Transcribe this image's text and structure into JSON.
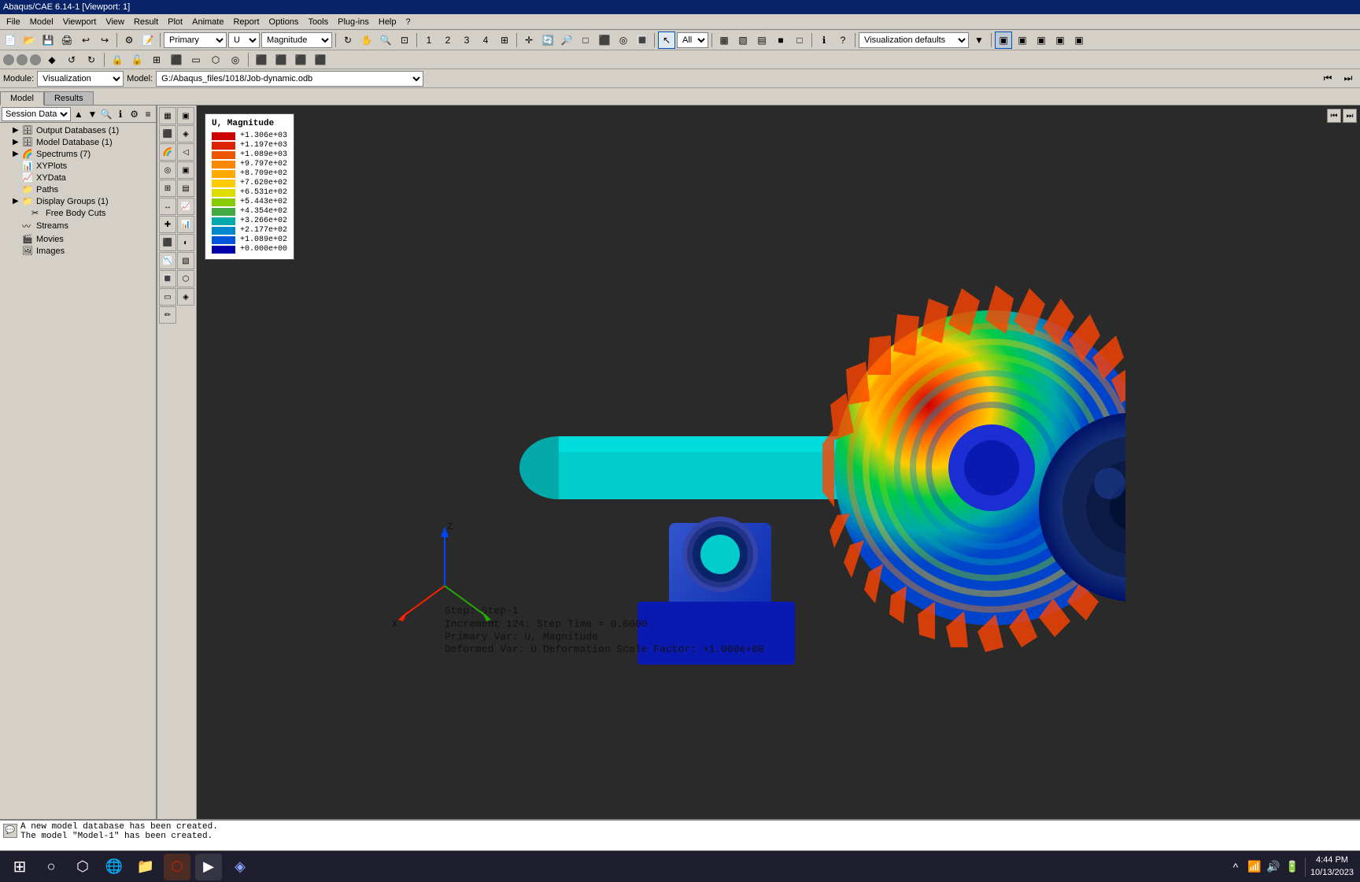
{
  "titlebar": {
    "text": "Abaqus/CAE 6.14-1 [Viewport: 1]"
  },
  "menubar": {
    "items": [
      "File",
      "Model",
      "Viewport",
      "View",
      "Result",
      "Plot",
      "Animate",
      "Report",
      "Options",
      "Tools",
      "Plug-ins",
      "Help",
      "?"
    ]
  },
  "toolbar1": {
    "module_label": "Module:",
    "module_value": "Visualization",
    "model_label": "Model:",
    "model_value": "G:/Abaqus_files/1018/Job-dynamic.odb",
    "primary_value": "Primary",
    "deform_value": "U",
    "contour_value": "Magnitude"
  },
  "tabs": {
    "model": "Model",
    "results": "Results"
  },
  "session": {
    "label": "Session Data",
    "dropdown_value": "Session Data"
  },
  "tree": {
    "items": [
      {
        "id": "output-db",
        "label": "Output Databases (1)",
        "indent": 1,
        "icon": "📁",
        "expand": "▶"
      },
      {
        "id": "model-db",
        "label": "Model Database (1)",
        "indent": 1,
        "icon": "📁",
        "expand": "▶"
      },
      {
        "id": "spectrums",
        "label": "Spectrums (7)",
        "indent": 1,
        "icon": "📁",
        "expand": "▶"
      },
      {
        "id": "xyplots",
        "label": "XYPlots",
        "indent": 1,
        "icon": "📊",
        "expand": " "
      },
      {
        "id": "xydata",
        "label": "XYData",
        "indent": 1,
        "icon": "📈",
        "expand": " "
      },
      {
        "id": "paths",
        "label": "Paths",
        "indent": 1,
        "icon": "📁",
        "expand": " "
      },
      {
        "id": "display-groups",
        "label": "Display Groups (1)",
        "indent": 1,
        "icon": "📁",
        "expand": "▶"
      },
      {
        "id": "free-body",
        "label": "Free Body Cuts",
        "indent": 2,
        "icon": "✂",
        "expand": " "
      },
      {
        "id": "streams",
        "label": "Streams",
        "indent": 1,
        "icon": "〰",
        "expand": " "
      },
      {
        "id": "movies",
        "label": "Movies",
        "indent": 1,
        "icon": "🎬",
        "expand": " "
      },
      {
        "id": "images",
        "label": "Images",
        "indent": 1,
        "icon": "🖼",
        "expand": " "
      }
    ]
  },
  "legend": {
    "title": "U, Magnitude",
    "entries": [
      {
        "color": "#cc0000",
        "value": "+1.306e+03"
      },
      {
        "color": "#dd2200",
        "value": "+1.197e+03"
      },
      {
        "color": "#ee5500",
        "value": "+1.089e+03"
      },
      {
        "color": "#ff8800",
        "value": "+9.797e+02"
      },
      {
        "color": "#ffaa00",
        "value": "+8.709e+02"
      },
      {
        "color": "#ffcc00",
        "value": "+7.620e+02"
      },
      {
        "color": "#dddd00",
        "value": "+6.531e+02"
      },
      {
        "color": "#88cc00",
        "value": "+5.443e+02"
      },
      {
        "color": "#44aa44",
        "value": "+4.354e+02"
      },
      {
        "color": "#00aaaa",
        "value": "+3.266e+02"
      },
      {
        "color": "#0088cc",
        "value": "+2.177e+02"
      },
      {
        "color": "#0055dd",
        "value": "+1.089e+02"
      },
      {
        "color": "#0000aa",
        "value": "+0.000e+00"
      }
    ]
  },
  "step_info": {
    "step": "Step: Step-1",
    "increment": "Increment    124:  Step Time =   0.6000",
    "primary_var": "Primary Var: U, Magnitude",
    "deformed_var": "Deformed Var: U   Deformation Scale Factor: +1.000e+00"
  },
  "console": {
    "line1": "A new model database has been created.",
    "line2": "The model \"Model-1\" has been created."
  },
  "taskbar": {
    "time": "4:44 PM",
    "date": "10/13/2023"
  }
}
